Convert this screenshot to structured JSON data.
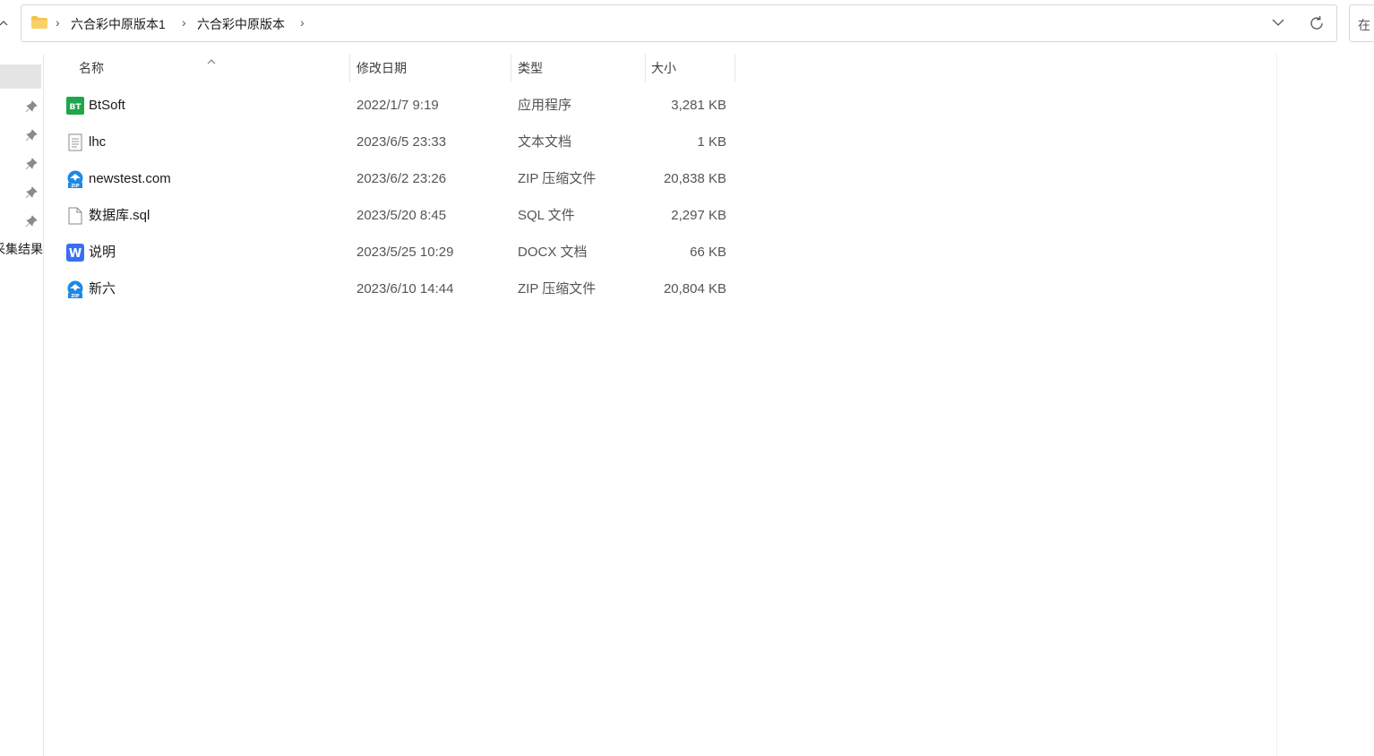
{
  "address_bar": {
    "breadcrumbs": [
      "六合彩中原版本1",
      "六合彩中原版本"
    ],
    "folder_icon": "folder-icon",
    "dropdown_icon": "chevron-down-icon",
    "refresh_icon": "refresh-icon"
  },
  "search": {
    "placeholder": "在"
  },
  "nav_pane": {
    "partial_label": "采集结果",
    "pinned_count": 5
  },
  "columns": {
    "name": "名称",
    "date": "修改日期",
    "type": "类型",
    "size": "大小"
  },
  "files": [
    {
      "name": "BtSoft",
      "date": "2022/1/7 9:19",
      "type": "应用程序",
      "size": "3,281 KB",
      "icon": "bt-app-icon"
    },
    {
      "name": "lhc",
      "date": "2023/6/5 23:33",
      "type": "文本文档",
      "size": "1 KB",
      "icon": "text-document-icon"
    },
    {
      "name": "newstest.com",
      "date": "2023/6/2 23:26",
      "type": "ZIP 压缩文件",
      "size": "20,838 KB",
      "icon": "zip-archive-icon"
    },
    {
      "name": "数据库.sql",
      "date": "2023/5/20 8:45",
      "type": "SQL 文件",
      "size": "2,297 KB",
      "icon": "blank-file-icon"
    },
    {
      "name": "说明",
      "date": "2023/5/25 10:29",
      "type": "DOCX 文档",
      "size": "66 KB",
      "icon": "word-document-icon"
    },
    {
      "name": "新六",
      "date": "2023/6/10 14:44",
      "type": "ZIP 压缩文件",
      "size": "20,804 KB",
      "icon": "zip-archive-icon"
    }
  ],
  "colors": {
    "bt_green": "#1fa64a",
    "word_blue": "#3b6ef0",
    "zip_blue": "#1e88e5",
    "folder_yellow": "#f5c242",
    "nav_selected": "#e5e5e5"
  }
}
